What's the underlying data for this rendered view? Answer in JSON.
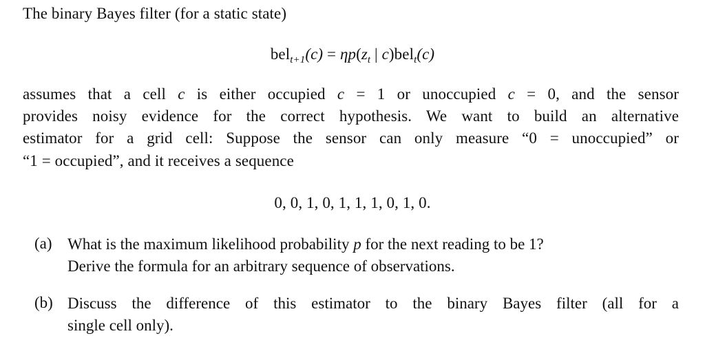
{
  "intro": {
    "heading": "The binary Bayes filter (for a static state)"
  },
  "equation": {
    "lhs_fn": "bel",
    "lhs_sub": "t+1",
    "lhs_arg": "(c)",
    "equals": " = ",
    "eta": "η",
    "p": "p",
    "open": "(",
    "z": "z",
    "z_sub": "t",
    "given": " | ",
    "c": "c",
    "close": ")",
    "rhs_fn": "bel",
    "rhs_sub": "t",
    "rhs_arg": "(c)"
  },
  "paragraph": {
    "line1_a": "assumes that a cell ",
    "line1_c1": "c",
    "line1_b": " is either occupied ",
    "line1_c2": "c",
    "line1_c": " = 1 or unoccupied ",
    "line1_c3": "c",
    "line1_d": " = 0, and the sensor",
    "line2": "provides noisy evidence for the correct hypothesis. We want to build an alternative",
    "line3": "estimator for a grid cell: Suppose the sensor can only measure “0 = unoccupied” or",
    "line4": "“1 = occupied”, and it receives a sequence"
  },
  "sequence": {
    "text": "0, 0, 1, 0, 1, 1, 1, 0, 1, 0.",
    "values": [
      0,
      0,
      1,
      0,
      1,
      1,
      1,
      0,
      1,
      0
    ]
  },
  "questions": [
    {
      "label": "(a)",
      "line1_a": "What is the maximum likelihood probability ",
      "line1_var": "p",
      "line1_b": " for the next reading to be 1?",
      "line2": "Derive the formula for an arbitrary sequence of observations."
    },
    {
      "label": "(b)",
      "line1": "Discuss the difference of this estimator to the binary Bayes filter (all for a",
      "line2": "single cell only)."
    }
  ]
}
